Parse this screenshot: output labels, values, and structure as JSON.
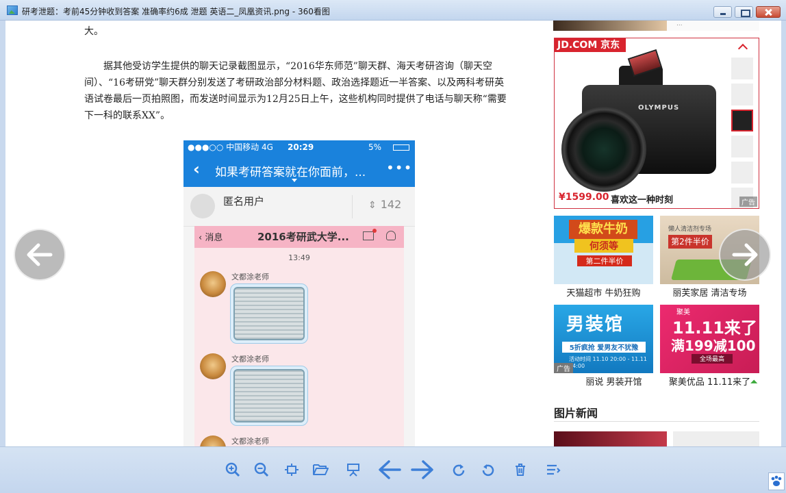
{
  "window": {
    "title": "研考泄题：考前45分钟收到答案 准确率约6成 泄题 英语二_凤凰资讯.png - 360看图"
  },
  "article": {
    "para1": "大。",
    "para2": "据其他受访学生提供的聊天记录截图显示，“2016华东师范”聊天群、海天考研咨询（聊天空间）、“16考研党”聊天群分别发送了考研政治部分材料题、政治选择题近一半答案、以及两科考研英语试卷最后一页拍照图，而发送时间显示为12月25日上午，这些机构同时提供了电话与聊天称“需要下一科的联系XX”。"
  },
  "phone": {
    "carrier": "●●●○○ 中国移动  4G",
    "time": "20:29",
    "battery": "5%",
    "nav_title": "如果考研答案就在你面前，...",
    "more": "•••",
    "user_name": "匿名用户",
    "votes": "142",
    "chat": {
      "back_label": "消息",
      "title": "2016考研武大学...",
      "time": "13:49",
      "messages": [
        {
          "sender": "文都涂老师"
        },
        {
          "sender": "文都涂老师"
        },
        {
          "sender": "文都涂老师"
        }
      ]
    }
  },
  "ads": {
    "top_strip_text": "...",
    "jd": {
      "logo": "JD.COM 京东",
      "camera_brand": "OLYMPUS",
      "price": "¥1599.00",
      "slogan": "喜欢这一种时刻",
      "ad_tag": "广告"
    },
    "tiles": [
      {
        "caption": "天猫超市 牛奶狂购",
        "line1": "爆款牛奶",
        "line2": "何须等",
        "line3": "第二件半价"
      },
      {
        "caption": "丽芙家居 清洁专场",
        "line1": "懒人清洁剂专场",
        "line2": "第2件半价"
      },
      {
        "caption": "丽说 男装开馆",
        "line1": "男装馆",
        "line2": "5折疯抢 爱男友不犹豫",
        "line3": "活动时间 11.10 20:00 - 11.11 24:00",
        "ad_tag": "广告"
      },
      {
        "caption": "聚美优品 11.11来了",
        "line0": "聚美",
        "line1": "11.11来了",
        "line2": "满199减100",
        "line3": "全场最高"
      }
    ],
    "news_heading": "图片新闻"
  },
  "toolbar": {
    "buttons": [
      "zoom-in",
      "zoom-out",
      "fit",
      "open",
      "slideshow",
      "prev",
      "next",
      "rotate-cw",
      "rotate-ccw",
      "delete",
      "menu"
    ]
  },
  "colors": {
    "accent": "#3d7fd8",
    "jd_red": "#d8242e",
    "phone_blue": "#1a82dc"
  }
}
